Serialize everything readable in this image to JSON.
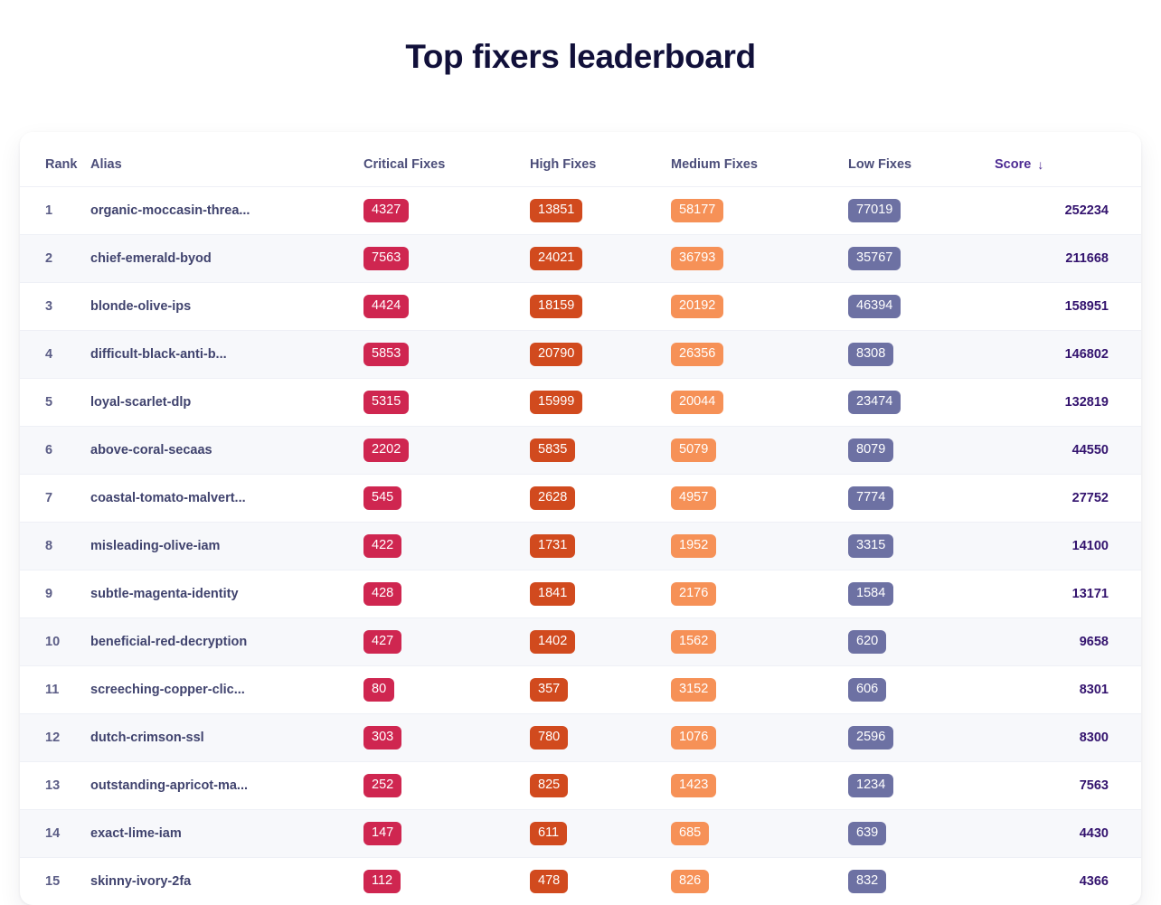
{
  "header": {
    "title": "Top fixers leaderboard"
  },
  "table": {
    "columns": [
      {
        "key": "rank",
        "label": "Rank"
      },
      {
        "key": "alias",
        "label": "Alias"
      },
      {
        "key": "critical",
        "label": "Critical Fixes"
      },
      {
        "key": "high",
        "label": "High Fixes"
      },
      {
        "key": "medium",
        "label": "Medium Fixes"
      },
      {
        "key": "low",
        "label": "Low Fixes"
      },
      {
        "key": "score",
        "label": "Score"
      }
    ],
    "sort": {
      "column": "Score",
      "direction": "desc",
      "icon": "arrow-down-icon",
      "glyph": "↓"
    },
    "colors": {
      "critical_badge": "#cf2650",
      "high_badge": "#d14a1e",
      "medium_badge": "#f69157",
      "low_badge": "#6d71a3",
      "score_text": "#33136e",
      "title_text": "#11103a",
      "header_text": "#4b4d79",
      "sort_active_text": "#4c2a92",
      "row_alt_background": "#f7f8fb",
      "card_background": "#ffffff",
      "page_background": "#ffffff"
    },
    "rows": [
      {
        "rank": "1",
        "alias": "organic-moccasin-threa...",
        "critical": "4327",
        "high": "13851",
        "medium": "58177",
        "low": "77019",
        "score": "252234"
      },
      {
        "rank": "2",
        "alias": "chief-emerald-byod",
        "critical": "7563",
        "high": "24021",
        "medium": "36793",
        "low": "35767",
        "score": "211668"
      },
      {
        "rank": "3",
        "alias": "blonde-olive-ips",
        "critical": "4424",
        "high": "18159",
        "medium": "20192",
        "low": "46394",
        "score": "158951"
      },
      {
        "rank": "4",
        "alias": "difficult-black-anti-b...",
        "critical": "5853",
        "high": "20790",
        "medium": "26356",
        "low": "8308",
        "score": "146802"
      },
      {
        "rank": "5",
        "alias": "loyal-scarlet-dlp",
        "critical": "5315",
        "high": "15999",
        "medium": "20044",
        "low": "23474",
        "score": "132819"
      },
      {
        "rank": "6",
        "alias": "above-coral-secaas",
        "critical": "2202",
        "high": "5835",
        "medium": "5079",
        "low": "8079",
        "score": "44550"
      },
      {
        "rank": "7",
        "alias": "coastal-tomato-malvert...",
        "critical": "545",
        "high": "2628",
        "medium": "4957",
        "low": "7774",
        "score": "27752"
      },
      {
        "rank": "8",
        "alias": "misleading-olive-iam",
        "critical": "422",
        "high": "1731",
        "medium": "1952",
        "low": "3315",
        "score": "14100"
      },
      {
        "rank": "9",
        "alias": "subtle-magenta-identity",
        "critical": "428",
        "high": "1841",
        "medium": "2176",
        "low": "1584",
        "score": "13171"
      },
      {
        "rank": "10",
        "alias": "beneficial-red-decryption",
        "critical": "427",
        "high": "1402",
        "medium": "1562",
        "low": "620",
        "score": "9658"
      },
      {
        "rank": "11",
        "alias": "screeching-copper-clic...",
        "critical": "80",
        "high": "357",
        "medium": "3152",
        "low": "606",
        "score": "8301"
      },
      {
        "rank": "12",
        "alias": "dutch-crimson-ssl",
        "critical": "303",
        "high": "780",
        "medium": "1076",
        "low": "2596",
        "score": "8300"
      },
      {
        "rank": "13",
        "alias": "outstanding-apricot-ma...",
        "critical": "252",
        "high": "825",
        "medium": "1423",
        "low": "1234",
        "score": "7563"
      },
      {
        "rank": "14",
        "alias": "exact-lime-iam",
        "critical": "147",
        "high": "611",
        "medium": "685",
        "low": "639",
        "score": "4430"
      },
      {
        "rank": "15",
        "alias": "skinny-ivory-2fa",
        "critical": "112",
        "high": "478",
        "medium": "826",
        "low": "832",
        "score": "4366"
      }
    ]
  }
}
